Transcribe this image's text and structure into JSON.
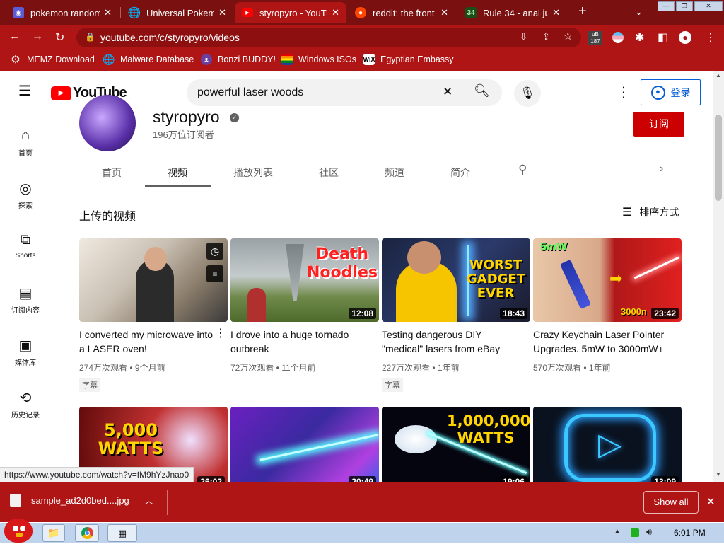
{
  "browser": {
    "tabs": [
      {
        "title": "pokemon random",
        "active": false,
        "color": "#5b5bd6"
      },
      {
        "title": "Universal Pokemo",
        "active": false,
        "color": "#ffffff"
      },
      {
        "title": "styropyro - YouTu",
        "active": true,
        "color": "#ff0000"
      },
      {
        "title": "reddit: the front p",
        "active": false,
        "color": "#ff4500"
      },
      {
        "title": "Rule 34 - anal juic",
        "active": false,
        "color": "#1a6b1a"
      }
    ],
    "new_tab": "+",
    "url": "youtube.com/c/styropyro/videos",
    "profile_badge": "187",
    "bookmarks": [
      "MEMZ Download",
      "Malware Database",
      "Bonzi BUDDY!",
      "Windows ISOs",
      "Egyptian Embassy"
    ],
    "tab_favicons": {
      "rule34": "34"
    },
    "wix_label": "WiX"
  },
  "youtube": {
    "logo": "YouTube",
    "search_value": "powerful laser woods",
    "sign_in": "登录",
    "sidebar": [
      {
        "icon": "home-icon",
        "label": "首页"
      },
      {
        "icon": "explore-icon",
        "label": "探索"
      },
      {
        "icon": "shorts-icon",
        "label": "Shorts"
      },
      {
        "icon": "subscriptions-icon",
        "label": "订阅内容"
      },
      {
        "icon": "library-icon",
        "label": "媒体库"
      },
      {
        "icon": "history-icon",
        "label": "历史记录"
      }
    ],
    "channel": {
      "name": "styropyro",
      "subscribers": "196万位订阅者",
      "subscribe": "订阅",
      "tabs": [
        "首页",
        "视频",
        "播放列表",
        "社区",
        "频道",
        "简介"
      ],
      "active_tab": "视频"
    },
    "section_title": "上传的视频",
    "sort_label": "排序方式",
    "videos": [
      {
        "title": "I converted my microwave into a LASER oven!",
        "meta": "274万次观看 • 9个月前",
        "badge": "字幕",
        "duration": ""
      },
      {
        "title": "I drove into a huge tornado outbreak",
        "meta": "72万次观看 • 11个月前",
        "badge": "",
        "duration": "12:08",
        "overlay": "Death Noodles"
      },
      {
        "title": "Testing dangerous DIY \"medical\" lasers from eBay",
        "meta": "227万次观看 • 1年前",
        "badge": "字幕",
        "duration": "18:43",
        "overlay": "WORST GADGET EVER"
      },
      {
        "title": "Crazy Keychain Laser Pointer Upgrades. 5mW to 3000mW+",
        "meta": "570万次观看 • 1年前",
        "badge": "",
        "duration": "23:42",
        "overlay_a": "5mW",
        "overlay_b": "3000n"
      }
    ],
    "row2": [
      {
        "duration": "26:02",
        "overlay": "5,000 WATTS"
      },
      {
        "duration": "20:49"
      },
      {
        "duration": "19:06",
        "overlay": "1,000,000 WATTS"
      },
      {
        "duration": "13:09"
      }
    ]
  },
  "status_url": "https://www.youtube.com/watch?v=fM9hYzJnao0",
  "download": {
    "file": "sample_ad2d0bed....jpg",
    "show_all": "Show all"
  },
  "taskbar": {
    "time": "6:01 PM"
  }
}
